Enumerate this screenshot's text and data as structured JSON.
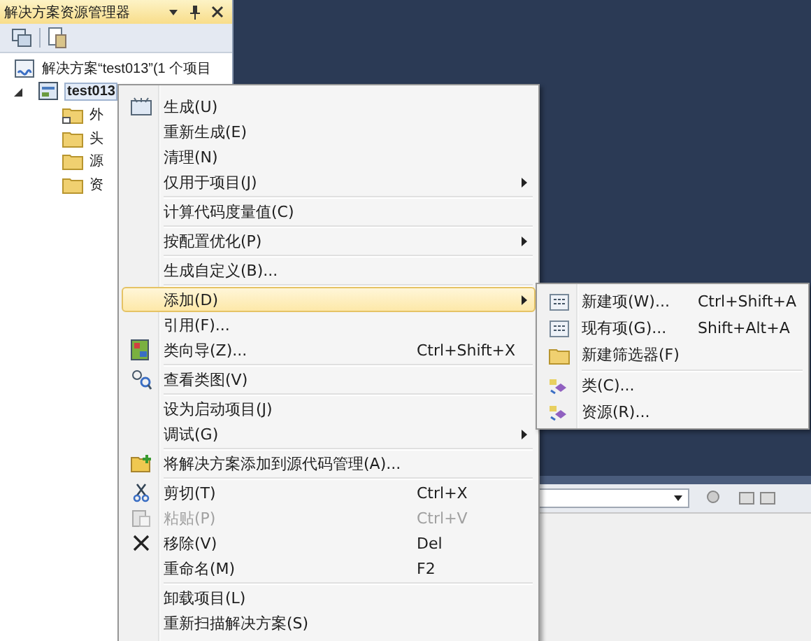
{
  "explorer": {
    "title": "解决方案资源管理器",
    "tree": [
      {
        "label": "解决方案“test013”(1 个项目",
        "kind": "solution",
        "selected": false
      },
      {
        "label": "test013",
        "kind": "project",
        "expanded": true,
        "selected": true,
        "children": [
          {
            "label": "外",
            "kind": "folder-ref",
            "selected": false
          },
          {
            "label": "头",
            "kind": "folder",
            "selected": false
          },
          {
            "label": "源",
            "kind": "folder",
            "selected": false
          },
          {
            "label": "资",
            "kind": "folder",
            "selected": false
          }
        ]
      }
    ]
  },
  "context_menu": {
    "groups": [
      [
        {
          "label": "生成(U)",
          "kind": "build",
          "submenu": false,
          "selected": false,
          "disabled": false
        },
        {
          "label": "重新生成(E)",
          "kind": "plain",
          "submenu": false,
          "selected": false,
          "disabled": false
        },
        {
          "label": "清理(N)",
          "kind": "plain",
          "submenu": false,
          "selected": false,
          "disabled": false
        },
        {
          "label": "仅用于项目(J)",
          "kind": "plain",
          "submenu": true,
          "selected": false,
          "disabled": false
        }
      ],
      [
        {
          "label": "计算代码度量值(C)",
          "kind": "plain",
          "submenu": false,
          "selected": false,
          "disabled": false
        }
      ],
      [
        {
          "label": "按配置优化(P)",
          "kind": "plain",
          "submenu": true,
          "selected": false,
          "disabled": false
        }
      ],
      [
        {
          "label": "生成自定义(B)...",
          "kind": "plain",
          "submenu": false,
          "selected": false,
          "disabled": false
        }
      ],
      [
        {
          "label": "添加(D)",
          "kind": "plain",
          "submenu": true,
          "selected": true,
          "disabled": false
        },
        {
          "label": "引用(F)...",
          "kind": "plain",
          "submenu": false,
          "selected": false,
          "disabled": false
        },
        {
          "label": "类向导(Z)...",
          "kind": "wizard",
          "shortcut": "Ctrl+Shift+X",
          "submenu": false,
          "selected": false,
          "disabled": false
        }
      ],
      [
        {
          "label": "查看类图(V)",
          "kind": "class-diagram",
          "submenu": false,
          "selected": false,
          "disabled": false
        }
      ],
      [
        {
          "label": "设为启动项目(J)",
          "kind": "plain",
          "submenu": false,
          "selected": false,
          "disabled": false
        },
        {
          "label": "调试(G)",
          "kind": "plain",
          "submenu": true,
          "selected": false,
          "disabled": false
        }
      ],
      [
        {
          "label": "将解决方案添加到源代码管理(A)...",
          "kind": "source-control",
          "submenu": false,
          "selected": false,
          "disabled": false
        }
      ],
      [
        {
          "label": "剪切(T)",
          "kind": "cut",
          "shortcut": "Ctrl+X",
          "submenu": false,
          "selected": false,
          "disabled": false
        },
        {
          "label": "粘贴(P)",
          "kind": "paste",
          "shortcut": "Ctrl+V",
          "submenu": false,
          "selected": false,
          "disabled": true
        },
        {
          "label": "移除(V)",
          "kind": "delete",
          "shortcut": "Del",
          "submenu": false,
          "selected": false,
          "disabled": false
        },
        {
          "label": "重命名(M)",
          "kind": "plain",
          "shortcut": "F2",
          "submenu": false,
          "selected": false,
          "disabled": false
        }
      ],
      [
        {
          "label": "卸载项目(L)",
          "kind": "plain",
          "submenu": false,
          "selected": false,
          "disabled": false
        },
        {
          "label": "重新扫描解决方案(S)",
          "kind": "plain",
          "submenu": false,
          "selected": false,
          "disabled": false
        }
      ]
    ]
  },
  "submenu": {
    "groups": [
      [
        {
          "label": "新建项(W)...",
          "kind": "grid",
          "shortcut": "Ctrl+Shift+A"
        },
        {
          "label": "现有项(G)...",
          "kind": "grid",
          "shortcut": "Shift+Alt+A"
        },
        {
          "label": "新建筛选器(F)",
          "kind": "folder"
        }
      ],
      [
        {
          "label": "类(C)...",
          "kind": "class"
        },
        {
          "label": "资源(R)...",
          "kind": "class"
        }
      ]
    ]
  }
}
